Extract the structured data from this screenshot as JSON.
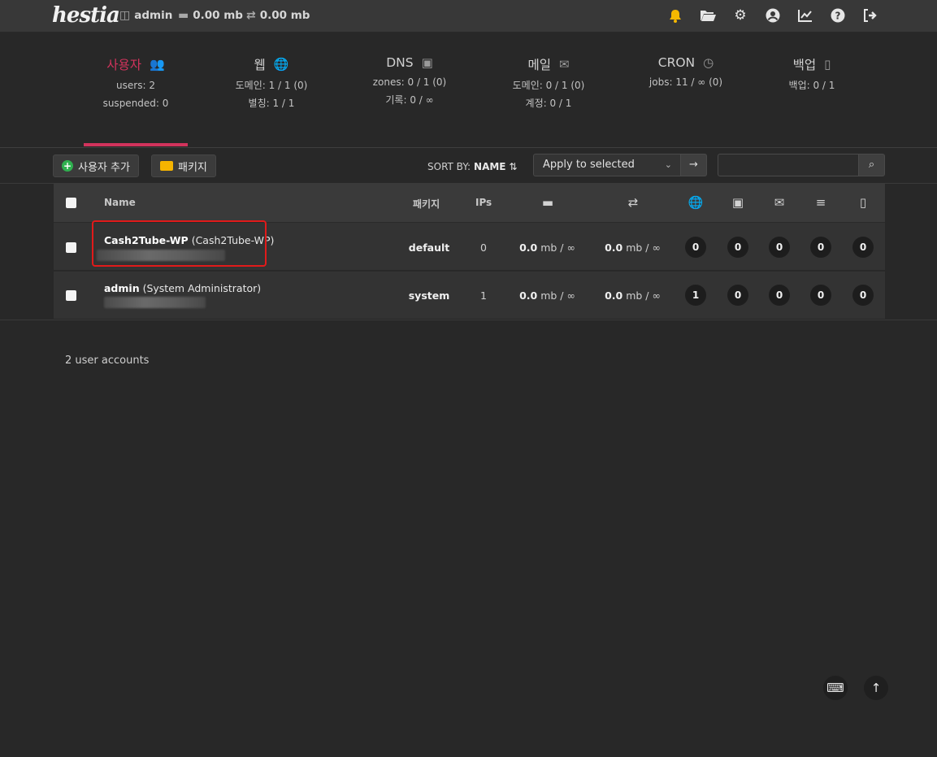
{
  "topbar": {
    "logo": "hestia",
    "user": "admin",
    "disk": "0.00 mb",
    "bandwidth": "0.00 mb",
    "icons": [
      "bell-icon",
      "folder-icon",
      "gear-icon",
      "user-circle-icon",
      "chart-icon",
      "help-icon",
      "logout-icon"
    ]
  },
  "summary": [
    {
      "title": "사용자",
      "icon": "users-icon",
      "line1": "users: 2",
      "line2": "suspended: 0",
      "active": true
    },
    {
      "title": "웹",
      "icon": "globe-icon",
      "line1": "도메인: 1 / 1 (0)",
      "line2": "별칭: 1 / 1"
    },
    {
      "title": "DNS",
      "icon": "address-book-icon",
      "line1": "zones: 0 / 1 (0)",
      "line2": "기록: 0 / ∞"
    },
    {
      "title": "메일",
      "icon": "mail-bulk-icon",
      "line1": "도메인: 0 / 1 (0)",
      "line2": "계정: 0 / 1"
    },
    {
      "title": "CRON",
      "icon": "clock-icon",
      "line1": "jobs: 11 / ∞ (0)",
      "line2": ""
    },
    {
      "title": "백업",
      "icon": "file-zip-icon",
      "line1": "백업: 0 / 1",
      "line2": ""
    }
  ],
  "toolbar": {
    "add_user": "사용자 추가",
    "packages": "패키지",
    "sort_by_label": "SORT BY:",
    "sort_by_value": "NAME",
    "apply_select": "Apply to selected",
    "search_placeholder": ""
  },
  "table": {
    "headers": {
      "name": "Name",
      "package": "패키지",
      "ips": "IPs"
    },
    "header_icons": [
      "disk-icon",
      "bandwidth-icon",
      "globe-icon",
      "address-book-icon",
      "mail-bulk-icon",
      "database-icon",
      "file-zip-icon"
    ],
    "rows": [
      {
        "user": "Cash2Tube-WP",
        "fullname": "(Cash2Tube-WP)",
        "package": "default",
        "ips": "0",
        "disk_val": "0.0",
        "disk_unit": "mb / ∞",
        "bw_val": "0.0",
        "bw_unit": "mb / ∞",
        "web": "0",
        "dns": "0",
        "mail": "0",
        "db": "0",
        "backup": "0"
      },
      {
        "user": "admin",
        "fullname": "(System Administrator)",
        "package": "system",
        "ips": "1",
        "disk_val": "0.0",
        "disk_unit": "mb / ∞",
        "bw_val": "0.0",
        "bw_unit": "mb / ∞",
        "web": "1",
        "dns": "0",
        "mail": "0",
        "db": "0",
        "backup": "0"
      }
    ]
  },
  "footer": {
    "count": "2 user accounts"
  },
  "colors": {
    "accent": "#d2335c",
    "bell": "#f5b800",
    "add_green": "#2fb04f",
    "highlight": "#e11a1a"
  }
}
